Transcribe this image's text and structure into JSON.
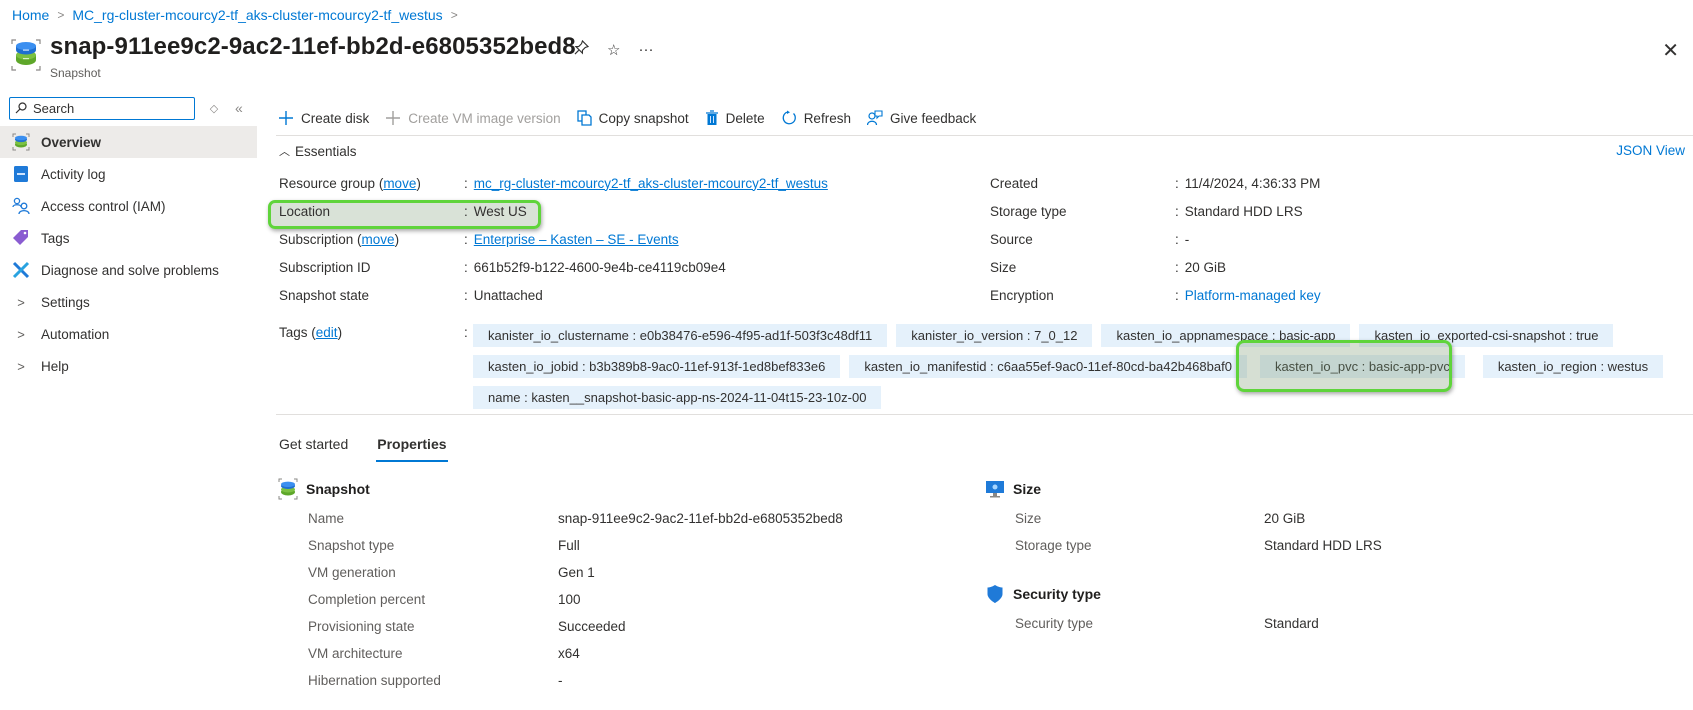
{
  "breadcrumb": [
    {
      "label": "Home"
    },
    {
      "label": "MC_rg-cluster-mcourcy2-tf_aks-cluster-mcourcy2-tf_westus"
    }
  ],
  "header": {
    "title": "snap-911ee9c2-9ac2-11ef-bb2d-e6805352bed8",
    "subtitle": "Snapshot",
    "icons": [
      "pin-icon",
      "star-icon",
      "more-icon",
      "close-icon"
    ],
    "pin": "⚲",
    "star": "☆",
    "more": "···",
    "close": "✕"
  },
  "sidebar": {
    "search_placeholder": "Search",
    "sort_glyph": "◇",
    "collapse_glyph": "«",
    "items": [
      {
        "label": "Overview",
        "icon": "snapshot-icon",
        "active": true
      },
      {
        "label": "Activity log",
        "icon": "activity-log-icon"
      },
      {
        "label": "Access control (IAM)",
        "icon": "iam-icon"
      },
      {
        "label": "Tags",
        "icon": "tag-icon"
      },
      {
        "label": "Diagnose and solve problems",
        "icon": "wrench-icon"
      },
      {
        "label": "Settings",
        "icon": "chevron-right-icon",
        "expandable": true
      },
      {
        "label": "Automation",
        "icon": "chevron-right-icon",
        "expandable": true
      },
      {
        "label": "Help",
        "icon": "chevron-right-icon",
        "expandable": true
      }
    ]
  },
  "toolbar": {
    "create_disk": "Create disk",
    "create_vm_image_version": "Create VM image version",
    "copy_snapshot": "Copy snapshot",
    "delete": "Delete",
    "refresh": "Refresh",
    "give_feedback": "Give feedback"
  },
  "essentials": {
    "toggle_label": "Essentials",
    "json_view": "JSON View",
    "left": {
      "resource_group_label": "Resource group",
      "move": "move",
      "resource_group_value": "mc_rg-cluster-mcourcy2-tf_aks-cluster-mcourcy2-tf_westus",
      "location_label": "Location",
      "location_value": "West US",
      "subscription_label": "Subscription",
      "subscription_value": "Enterprise – Kasten – SE - Events",
      "subscription_id_label": "Subscription ID",
      "subscription_id_value": "661b52f9-b122-4600-9e4b-ce4119cb09e4",
      "snapshot_state_label": "Snapshot state",
      "snapshot_state_value": "Unattached"
    },
    "right": {
      "created_label": "Created",
      "created_value": "11/4/2024, 4:36:33 PM",
      "storage_type_label": "Storage type",
      "storage_type_value": "Standard HDD LRS",
      "source_label": "Source",
      "source_value": "-",
      "size_label": "Size",
      "size_value": "20 GiB",
      "encryption_label": "Encryption",
      "encryption_value": "Platform-managed key"
    },
    "tags_label": "Tags",
    "tags_edit": "edit",
    "tags": [
      "kanister_io_clustername : e0b38476-e596-4f95-ad1f-503f3c48df11",
      "kanister_io_version : 7_0_12",
      "kasten_io_appnamespace : basic-app",
      "kasten_io_exported-csi-snapshot : true",
      "kasten_io_jobid : b3b389b8-9ac0-11ef-913f-1ed8bef833e6",
      "kasten_io_manifestid : c6aa55ef-9ac0-11ef-80cd-ba42b468baf0",
      "kasten_io_pvc : basic-app-pvc",
      "kasten_io_region : westus",
      "name : kasten__snapshot-basic-app-ns-2024-11-04t15-23-10z-00"
    ]
  },
  "tabs": [
    {
      "label": "Get started",
      "active": false
    },
    {
      "label": "Properties",
      "active": true
    }
  ],
  "properties": {
    "snapshot": {
      "heading": "Snapshot",
      "rows": [
        {
          "label": "Name",
          "value": "snap-911ee9c2-9ac2-11ef-bb2d-e6805352bed8"
        },
        {
          "label": "Snapshot type",
          "value": "Full"
        },
        {
          "label": "VM generation",
          "value": "Gen 1"
        },
        {
          "label": "Completion percent",
          "value": "100"
        },
        {
          "label": "Provisioning state",
          "value": "Succeeded"
        },
        {
          "label": "VM architecture",
          "value": "x64"
        },
        {
          "label": "Hibernation supported",
          "value": "-"
        }
      ]
    },
    "size": {
      "heading": "Size",
      "rows": [
        {
          "label": "Size",
          "value": "20 GiB"
        },
        {
          "label": "Storage type",
          "value": "Standard HDD LRS"
        }
      ]
    },
    "security": {
      "heading": "Security type",
      "rows": [
        {
          "label": "Security type",
          "value": "Standard"
        }
      ]
    }
  },
  "colors": {
    "accent": "#0078d4",
    "highlight_border": "#5fd43b",
    "tag_bg": "#e5f1fb",
    "active_nav_bg": "#edebe9"
  }
}
